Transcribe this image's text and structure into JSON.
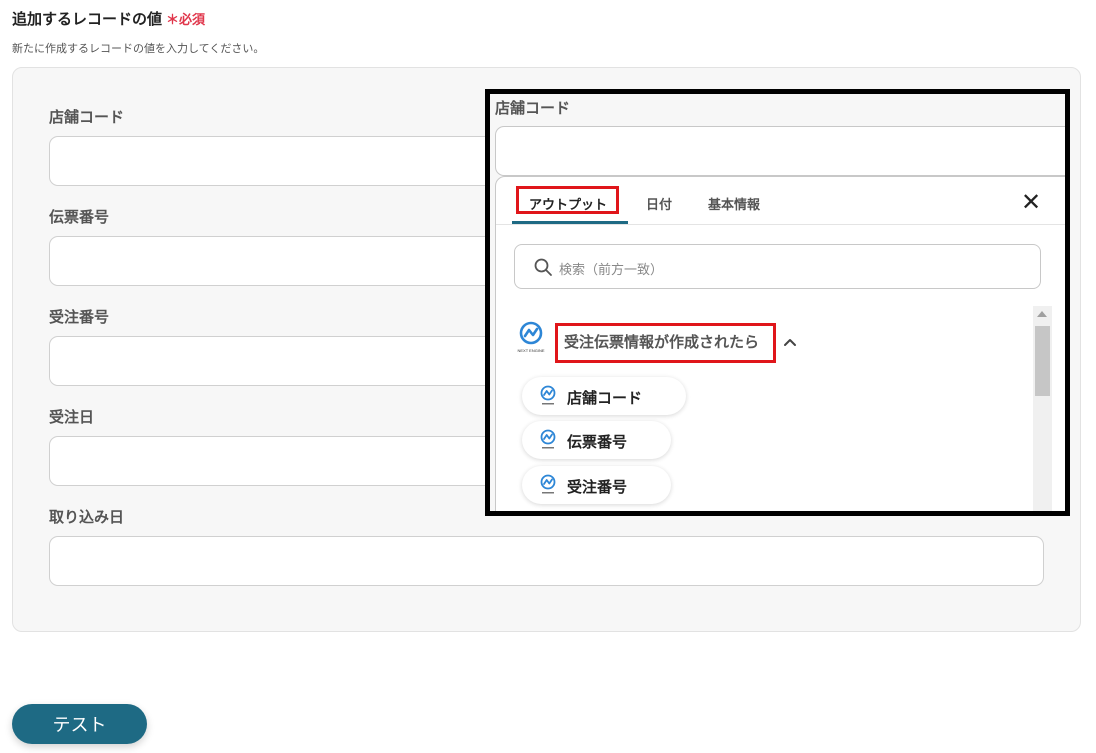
{
  "header": {
    "title": "追加するレコードの値",
    "required": "＊必須",
    "description": "新たに作成するレコードの値を入力してください。"
  },
  "fields": [
    {
      "label": "店舗コード",
      "value": ""
    },
    {
      "label": "伝票番号",
      "value": ""
    },
    {
      "label": "受注番号",
      "value": ""
    },
    {
      "label": "受注日",
      "value": ""
    },
    {
      "label": "取り込み日",
      "value": ""
    }
  ],
  "test_button": "テスト",
  "overlay": {
    "field_label": "店舗コード",
    "tabs": [
      "アウトプット",
      "日付",
      "基本情報"
    ],
    "active_tab": "アウトプット",
    "search_placeholder": "検索（前方一致）",
    "group_title": "受注伝票情報が作成されたら",
    "logo_text": "NEXT ENGINE",
    "items": [
      "店舗コード",
      "伝票番号",
      "受注番号"
    ],
    "colors": {
      "accent": "#1e6a84",
      "highlight": "#e0161a",
      "logo": "#2d86d6"
    }
  }
}
